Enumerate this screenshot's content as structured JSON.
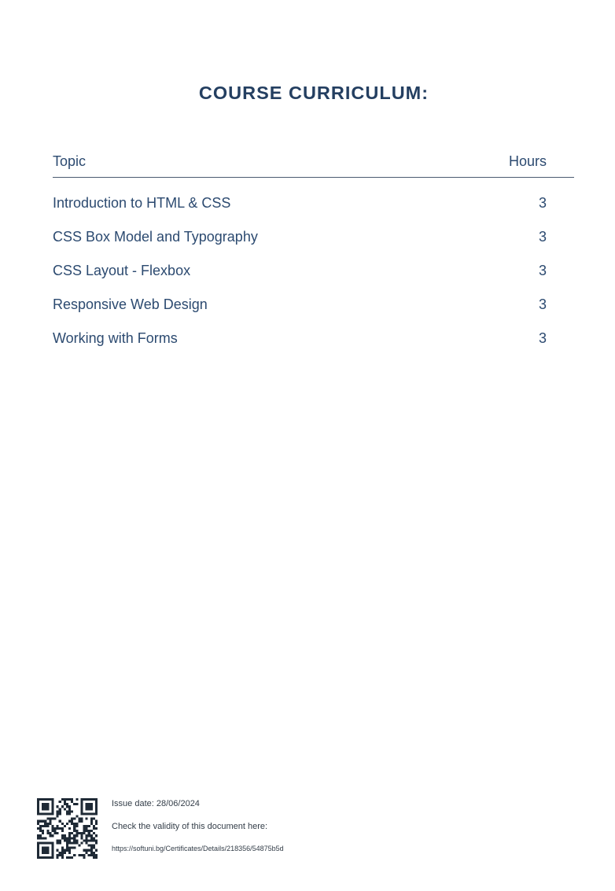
{
  "title": "COURSE CURRICULUM:",
  "table": {
    "headers": {
      "topic": "Topic",
      "hours": "Hours"
    },
    "rows": [
      {
        "topic": "Introduction to HTML & CSS",
        "hours": "3"
      },
      {
        "topic": "CSS Box Model and Typography",
        "hours": "3"
      },
      {
        "topic": "CSS Layout - Flexbox",
        "hours": "3"
      },
      {
        "topic": "Responsive Web Design",
        "hours": "3"
      },
      {
        "topic": "Working with Forms",
        "hours": "3"
      }
    ]
  },
  "footer": {
    "issue_date": "Issue date: 28/06/2024",
    "check_text": "Check the validity of this document here:",
    "url": "https://softuni.bg/Certificates/Details/218356/54875b5d"
  },
  "colors": {
    "title": "#243f61",
    "text": "#2c4a70",
    "rule": "#4a5a70"
  }
}
